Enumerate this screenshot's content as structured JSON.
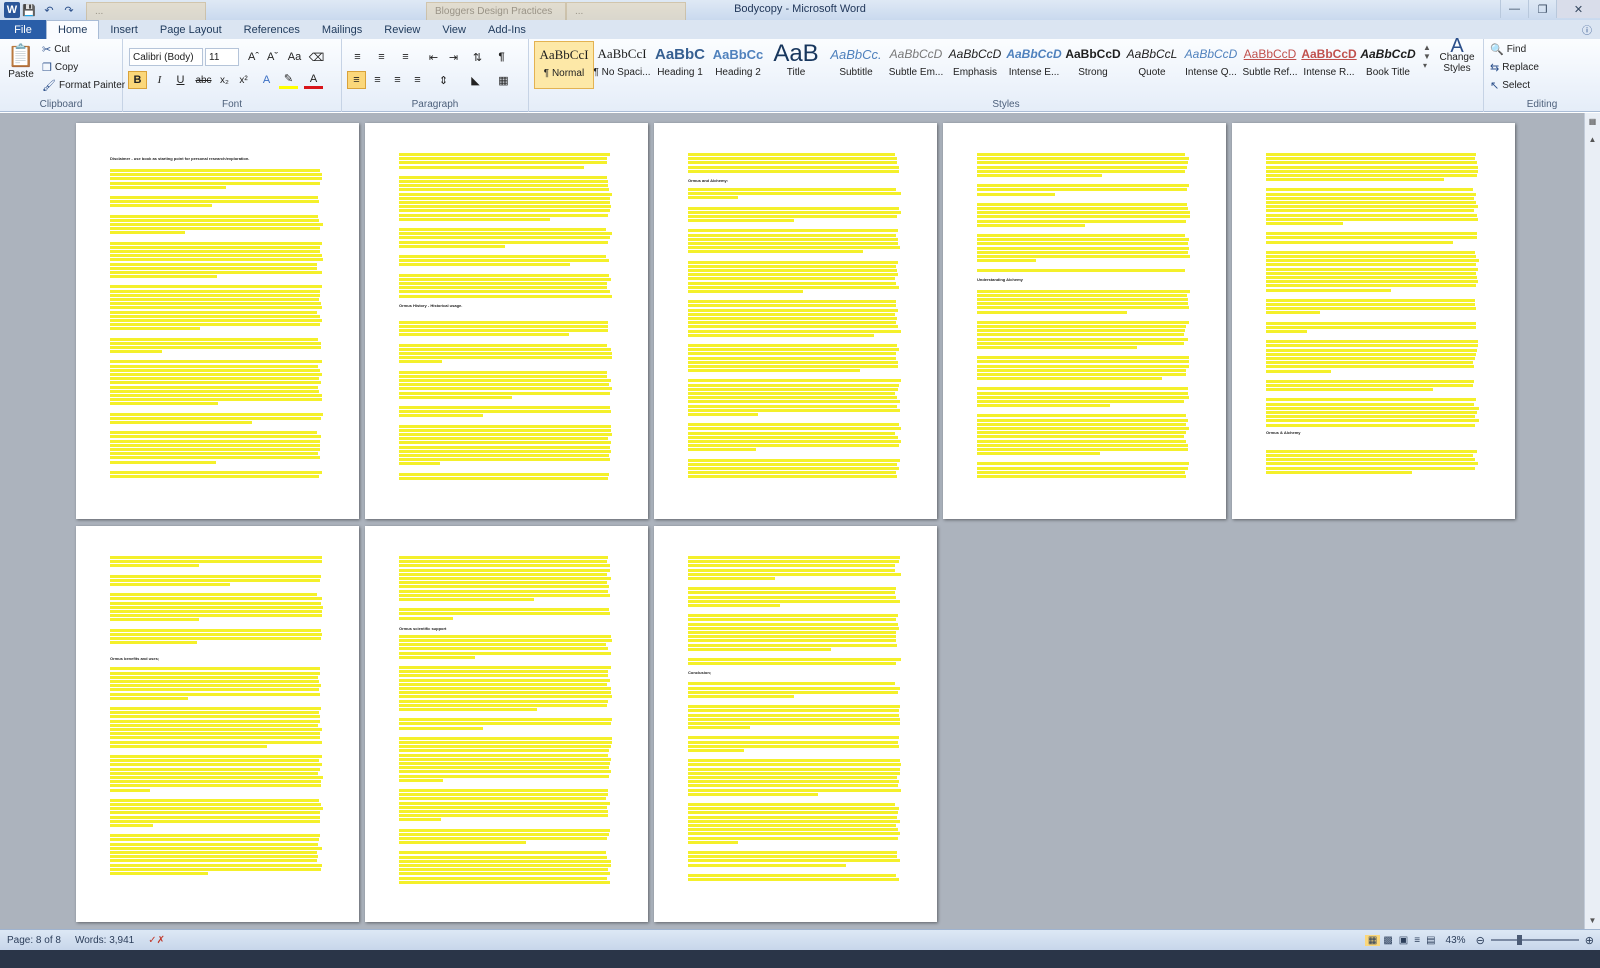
{
  "window": {
    "title": "Bodycopy - Microsoft Word",
    "background_tabs": [
      "...",
      "Bloggers Design Practices",
      "..."
    ]
  },
  "quick_access": {
    "icons": [
      "word-icon",
      "save-icon",
      "undo-icon",
      "redo-icon"
    ]
  },
  "tabs": [
    "Home",
    "Insert",
    "Page Layout",
    "References",
    "Mailings",
    "Review",
    "View",
    "Add-Ins"
  ],
  "file_tab": "File",
  "clipboard": {
    "paste": "Paste",
    "cut": "Cut",
    "copy": "Copy",
    "format_painter": "Format Painter",
    "label": "Clipboard"
  },
  "font": {
    "name": "Calibri (Body)",
    "size": "11",
    "label": "Font"
  },
  "paragraph": {
    "label": "Paragraph"
  },
  "styles": {
    "label": "Styles",
    "change_styles": "Change Styles",
    "items": [
      {
        "preview": "AaBbCcI",
        "name": "¶ Normal"
      },
      {
        "preview": "AaBbCcI",
        "name": "¶ No Spaci..."
      },
      {
        "preview": "AaBbC",
        "name": "Heading 1"
      },
      {
        "preview": "AaBbCc",
        "name": "Heading 2"
      },
      {
        "preview": "AaB",
        "name": "Title"
      },
      {
        "preview": "AaBbCc.",
        "name": "Subtitle"
      },
      {
        "preview": "AaBbCcD",
        "name": "Subtle Em..."
      },
      {
        "preview": "AaBbCcD",
        "name": "Emphasis"
      },
      {
        "preview": "AaBbCcD",
        "name": "Intense E..."
      },
      {
        "preview": "AaBbCcD",
        "name": "Strong"
      },
      {
        "preview": "AaBbCcL",
        "name": "Quote"
      },
      {
        "preview": "AaBbCcD",
        "name": "Intense Q..."
      },
      {
        "preview": "AaBbCcD",
        "name": "Subtle Ref..."
      },
      {
        "preview": "AaBbCcD",
        "name": "Intense R..."
      },
      {
        "preview": "AaBbCcD",
        "name": "Book Title"
      }
    ]
  },
  "editing": {
    "find": "Find",
    "replace": "Replace",
    "select": "Select",
    "label": "Editing"
  },
  "status": {
    "page": "Page: 8 of 8",
    "words": "Words: 3,941",
    "zoom": "43%"
  },
  "pages": [
    {
      "heading": "Disclaimer - use book as starting point for personal research/exploration."
    },
    {
      "heading": "Ormus History - Historical usage."
    },
    {
      "heading": "Ormus and Alchemy:"
    },
    {
      "heading": "Understanding Alchemy"
    },
    {
      "heading": "Ormus & Alchemy"
    },
    {
      "heading": "Ormus benefits and uses;"
    },
    {
      "heading": "Ormus scientific support"
    },
    {
      "heading": "Conclusion;"
    }
  ]
}
